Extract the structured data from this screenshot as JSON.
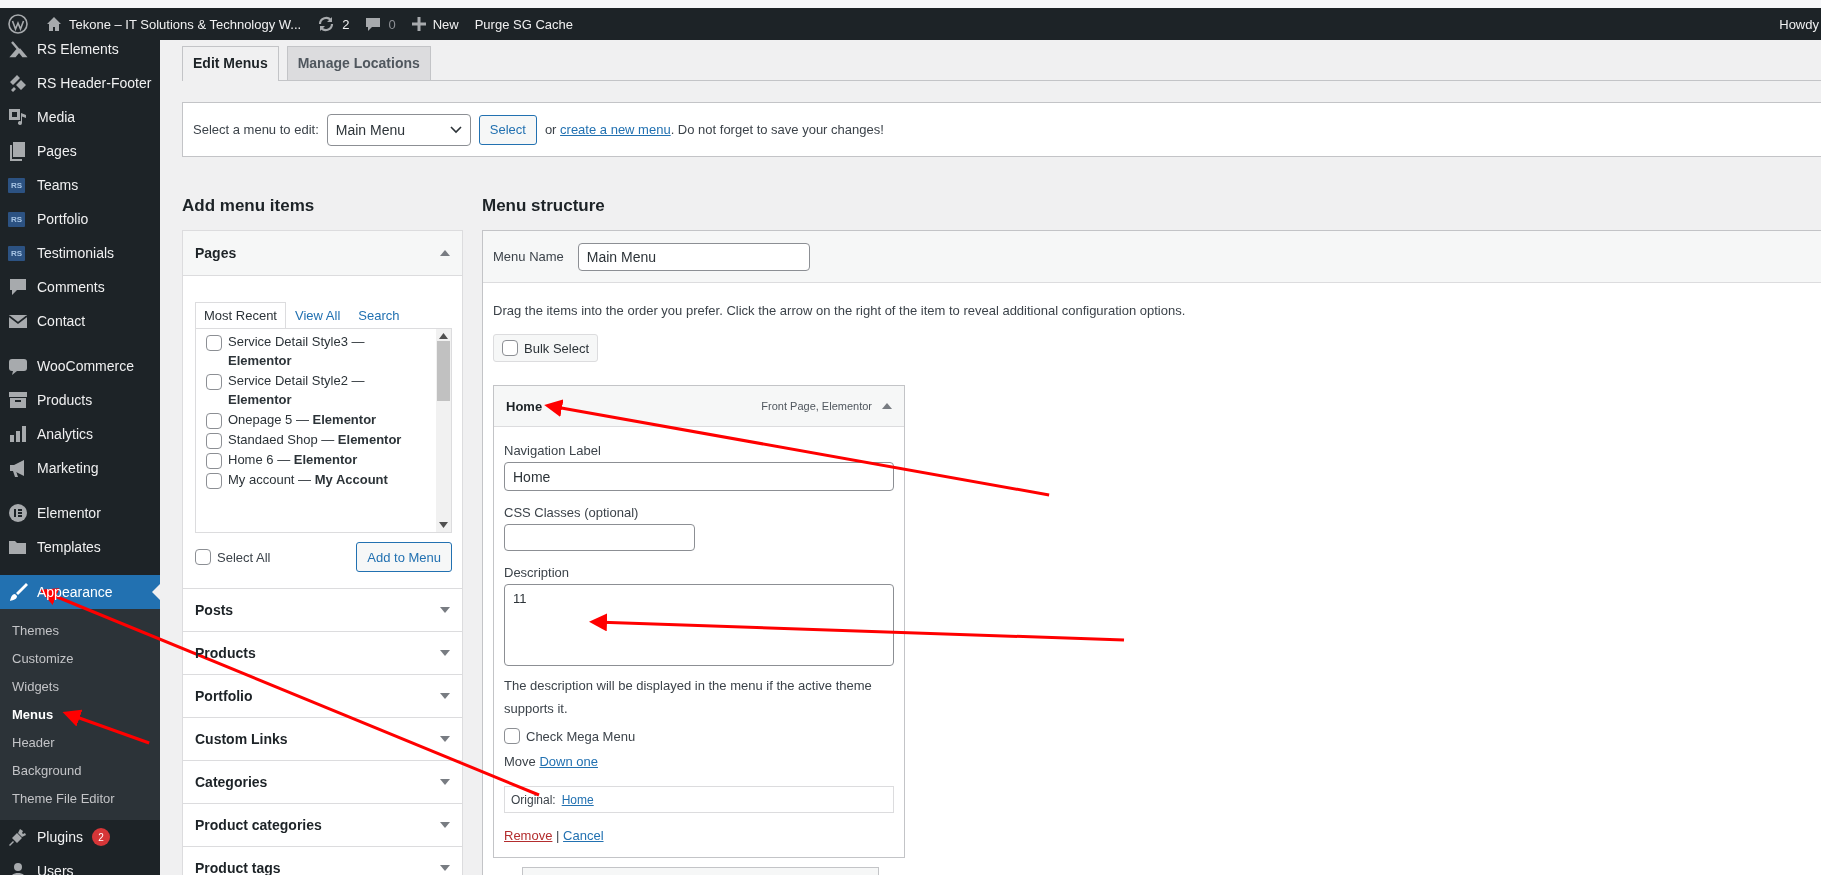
{
  "admin_bar": {
    "site_name": "Tekone – IT Solutions & Technology W...",
    "updates_count": "2",
    "comments_count": "0",
    "new_label": "New",
    "purge_label": "Purge SG Cache",
    "howdy": "Howdy"
  },
  "sidebar": {
    "groups": [
      {
        "items": [
          {
            "label": "RS Elements",
            "selected": false
          },
          {
            "label": "RS Header-Footer",
            "selected": false
          },
          {
            "label": "Media",
            "selected": false
          },
          {
            "label": "Pages",
            "selected": false
          },
          {
            "label": "Teams",
            "selected": false,
            "icon_text": "RS"
          },
          {
            "label": "Portfolio",
            "selected": false,
            "icon_text": "RS"
          },
          {
            "label": "Testimonials",
            "selected": false,
            "icon_text": "RS"
          },
          {
            "label": "Comments",
            "selected": false
          },
          {
            "label": "Contact",
            "selected": false
          }
        ]
      },
      {
        "items": [
          {
            "label": "WooCommerce",
            "selected": false
          },
          {
            "label": "Products",
            "selected": false
          },
          {
            "label": "Analytics",
            "selected": false
          },
          {
            "label": "Marketing",
            "selected": false
          }
        ]
      },
      {
        "items": [
          {
            "label": "Elementor",
            "selected": false
          },
          {
            "label": "Templates",
            "selected": false
          }
        ]
      },
      {
        "items": [
          {
            "label": "Appearance",
            "selected": true,
            "children": [
              {
                "label": "Themes",
                "selected": false
              },
              {
                "label": "Customize",
                "selected": false
              },
              {
                "label": "Widgets",
                "selected": false
              },
              {
                "label": "Menus",
                "selected": true
              },
              {
                "label": "Header",
                "selected": false
              },
              {
                "label": "Background",
                "selected": false
              },
              {
                "label": "Theme File Editor",
                "selected": false
              }
            ]
          },
          {
            "label": "Plugins",
            "selected": false,
            "badge": "2"
          },
          {
            "label": "Users",
            "selected": false
          }
        ]
      }
    ]
  },
  "tabs": [
    {
      "label": "Edit Menus",
      "selected": true
    },
    {
      "label": "Manage Locations",
      "selected": false
    }
  ],
  "menu_select": {
    "label": "Select a menu to edit:",
    "value": "Main Menu",
    "button": "Select",
    "note_before": "or",
    "note_link": "create a new menu",
    "note_after": ". Do not forget to save your changes!"
  },
  "add_items": {
    "title": "Add menu items",
    "sections": [
      {
        "title": "Pages",
        "expanded": true,
        "tabs": [
          {
            "label": "Most Recent",
            "selected": true
          },
          {
            "label": "View All",
            "selected": false
          },
          {
            "label": "Search",
            "selected": false
          }
        ],
        "pages": [
          {
            "title": "Service Detail Style3 — **Elementor**",
            "checked": false
          },
          {
            "title": "Service Detail Style2 — **Elementor**",
            "checked": false
          },
          {
            "title": "Onepage 5 — **Elementor**",
            "checked": false
          },
          {
            "title": "Standaed Shop — **Elementor**",
            "checked": false
          },
          {
            "title": "Home 6 — **Elementor**",
            "checked": false
          },
          {
            "title": "My account — **My Account**",
            "checked": false
          }
        ],
        "select_all": "Select All",
        "select_all_checked": false,
        "add_button": "Add to Menu"
      },
      {
        "title": "Posts",
        "expanded": false
      },
      {
        "title": "Products",
        "expanded": false
      },
      {
        "title": "Portfolio",
        "expanded": false
      },
      {
        "title": "Custom Links",
        "expanded": false
      },
      {
        "title": "Categories",
        "expanded": false
      },
      {
        "title": "Product categories",
        "expanded": false
      },
      {
        "title": "Product tags",
        "expanded": false
      }
    ]
  },
  "menu_structure": {
    "title": "Menu structure",
    "name_label": "Menu Name",
    "name_value": "Main Menu",
    "instructions": "Drag the items into the order you prefer. Click the arrow on the right of the item to reveal additional configuration options.",
    "bulk_select": "Bulk Select",
    "bulk_checked": false,
    "items": [
      {
        "title": "Home",
        "type": "Front Page, Elementor",
        "expanded": true,
        "nav_label_label": "Navigation Label",
        "nav_label": "Home",
        "css_label": "CSS Classes (optional)",
        "description_label": "Description",
        "description": "11",
        "description_hint": "The description will be displayed in the menu if the active theme supports it.",
        "mega_label": "Check Mega Menu",
        "mega_checked": false,
        "move_label": "Move",
        "move_link": "Down one",
        "original_label": "Original:",
        "original_link": "Home",
        "remove": "Remove",
        "separator": "|",
        "cancel": "Cancel"
      },
      {
        "expanded": false
      }
    ]
  },
  "annotations": [
    {
      "kind": "arrow"
    },
    {
      "kind": "arrow"
    },
    {
      "kind": "arrow"
    },
    {
      "kind": "arrow"
    }
  ]
}
